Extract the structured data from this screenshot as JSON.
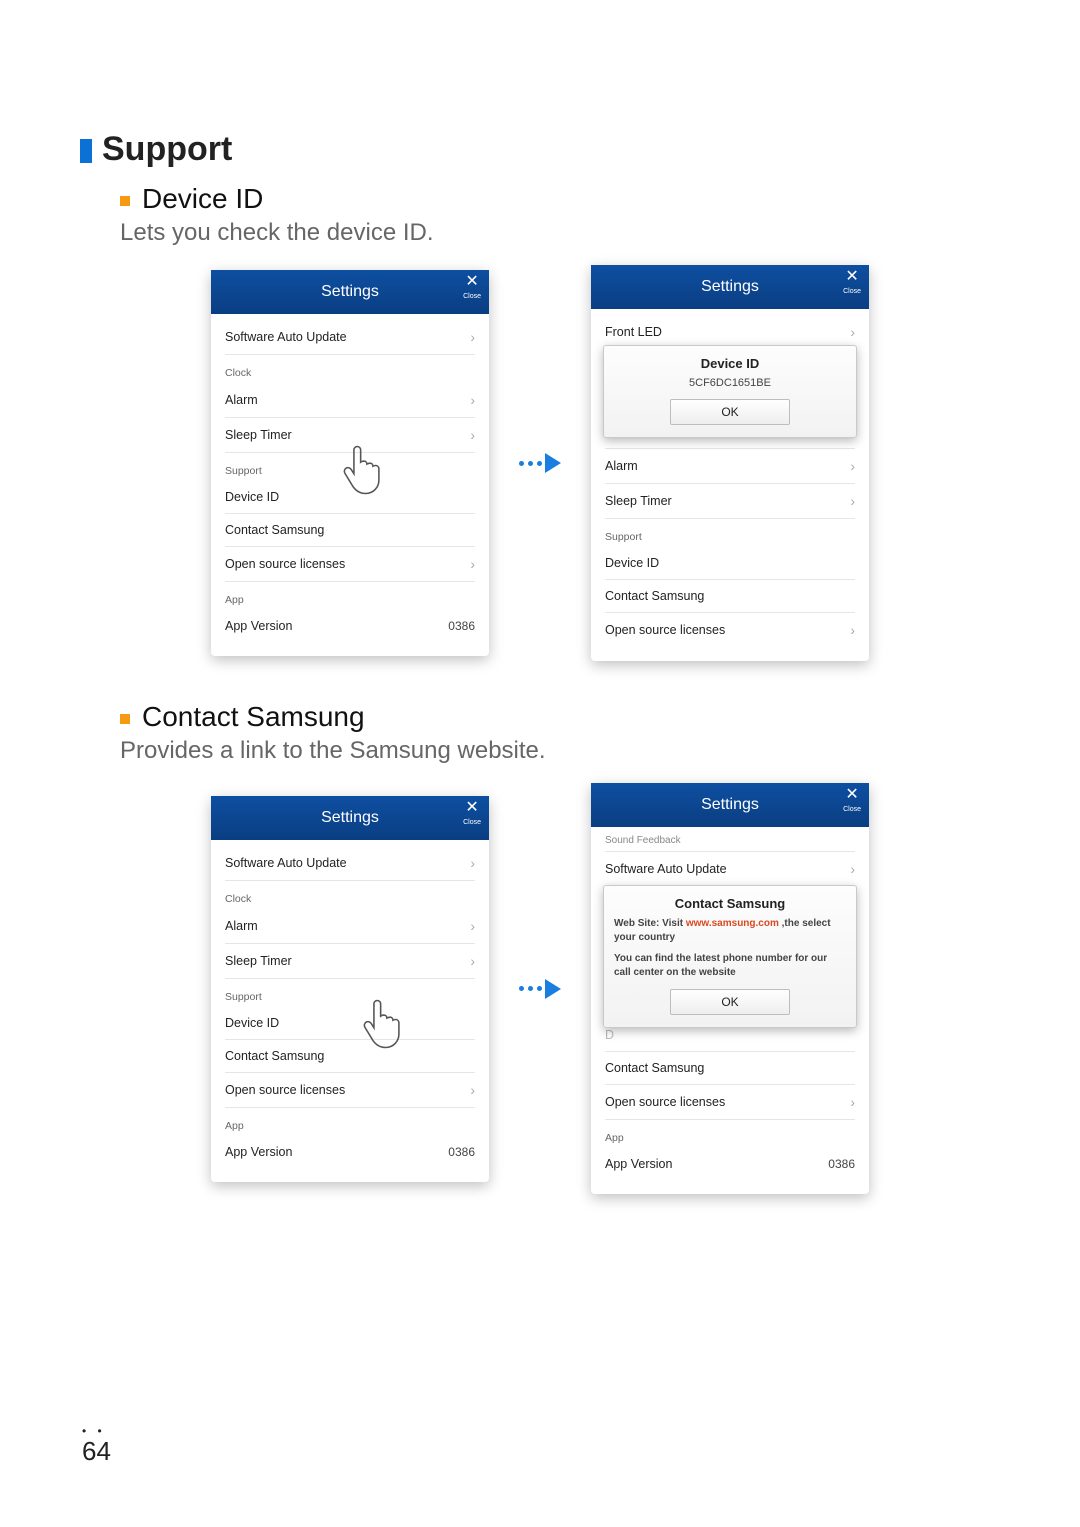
{
  "headings": {
    "support": "Support",
    "device_id": "Device ID",
    "device_id_desc": "Lets you check the device ID.",
    "contact_samsung": "Contact Samsung",
    "contact_samsung_desc": "Provides a link to the Samsung website."
  },
  "phone_header": {
    "title": "Settings",
    "close": "Close"
  },
  "settings_list": {
    "software_auto_update": "Software Auto Update",
    "clock_section": "Clock",
    "alarm": "Alarm",
    "sleep_timer": "Sleep Timer",
    "support_section": "Support",
    "device_id": "Device ID",
    "contact_samsung": "Contact Samsung",
    "open_source": "Open source licenses",
    "app_section": "App",
    "app_version": "App Version",
    "app_version_val": "0386",
    "front_led": "Front LED",
    "sound_feedback_partial": "Sound Feedback"
  },
  "popup_device_id": {
    "title": "Device ID",
    "value": "5CF6DC1651BE",
    "ok": "OK"
  },
  "popup_contact": {
    "title": "Contact Samsung",
    "line1_pre": "Web Site: Visit ",
    "line1_link": "www.samsung.com",
    "line1_post": " ,the select your country",
    "line2": "You can find the latest phone number for our call center on the website",
    "ok": "OK"
  },
  "page_number": "64"
}
